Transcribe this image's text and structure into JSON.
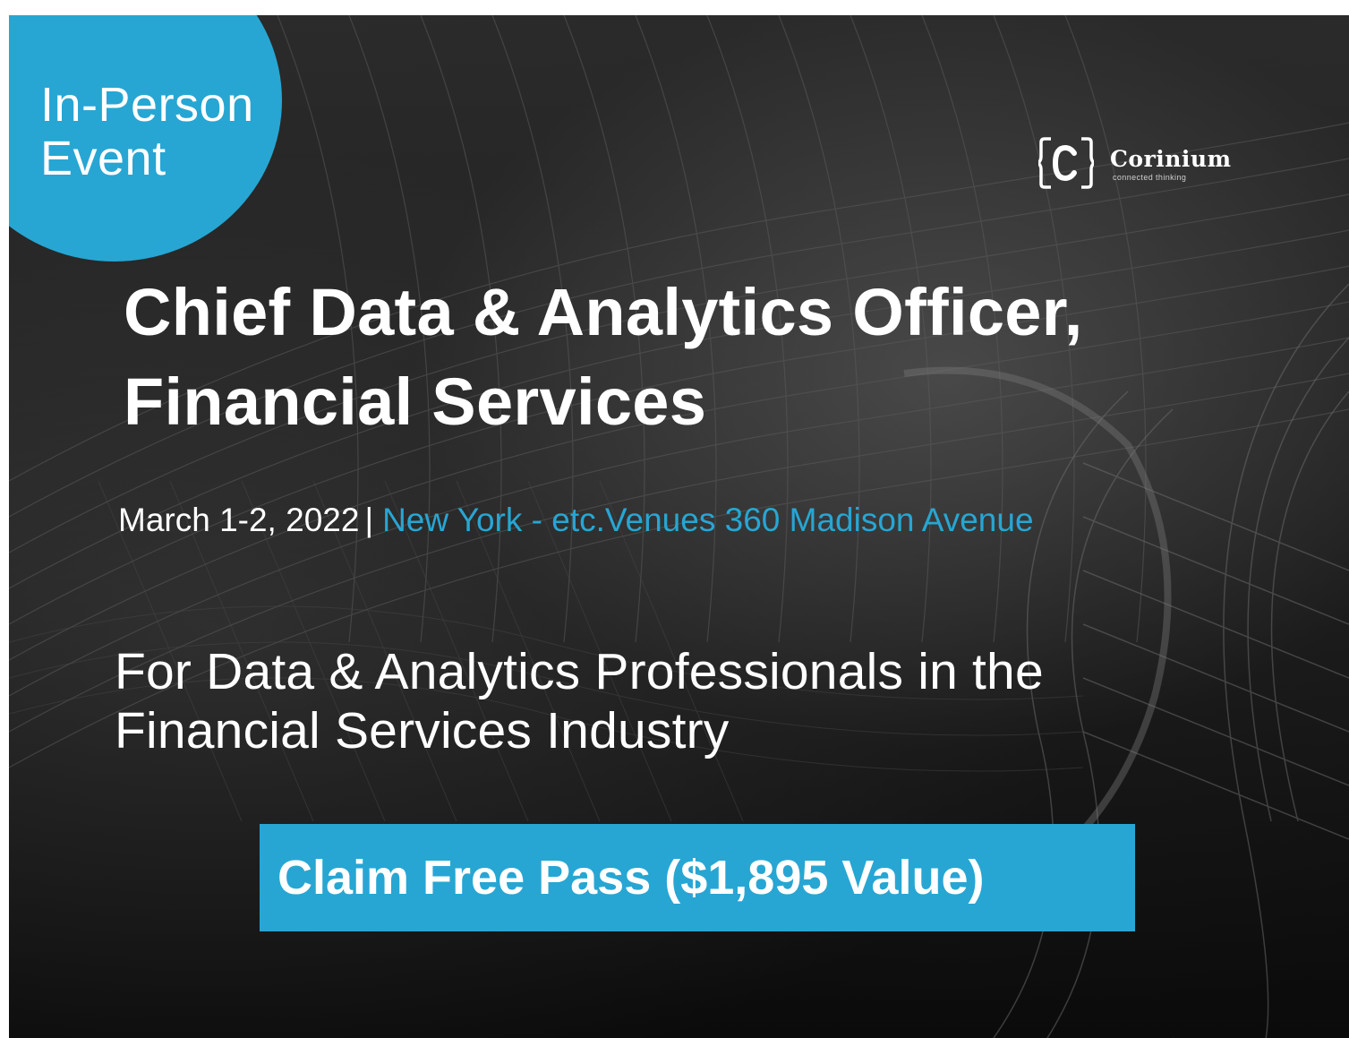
{
  "badge": {
    "line1": "In-Person",
    "line2": "Event",
    "color": "#27a6d3"
  },
  "logo": {
    "name": "Corinium",
    "tagline": "connected thinking",
    "icon": "bracket-c-icon"
  },
  "event": {
    "title_line1": "Chief Data & Analytics Officer,",
    "title_line2": "Financial Services",
    "date": "March 1-2, 2022",
    "separator": "|",
    "venue": "New York - etc.Venues 360 Madison Avenue",
    "audience_line1": "For Data & Analytics Professionals in the",
    "audience_line2": "Financial Services Industry"
  },
  "cta": {
    "label": "Claim Free Pass ($1,895 Value)",
    "color": "#27a6d3"
  },
  "colors": {
    "accent": "#27a6d3",
    "background": "#1c1c1c",
    "text": "#ffffff"
  }
}
